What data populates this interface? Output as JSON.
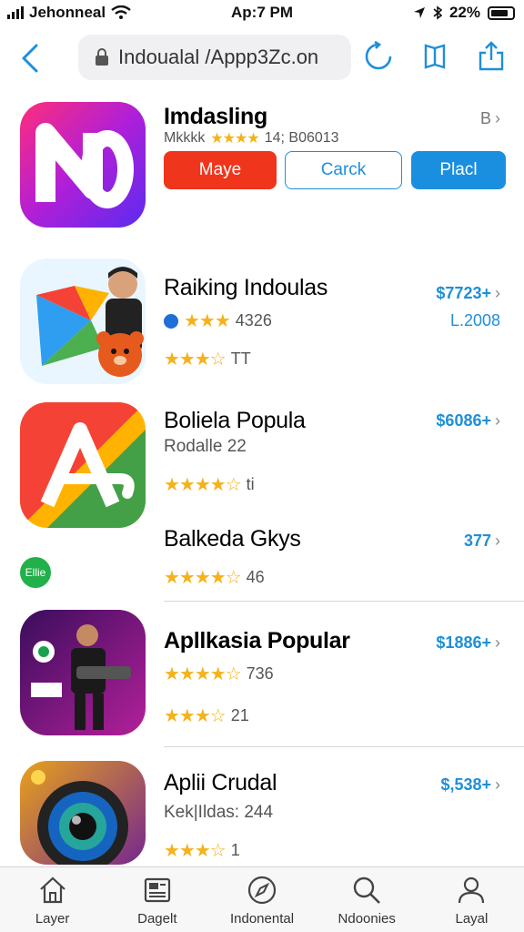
{
  "status": {
    "carrier": "Jehonneal",
    "time": "Ap:7 PM",
    "battery": "22%"
  },
  "nav": {
    "url": "Indoualal /Appp3Zc.on"
  },
  "apps": [
    {
      "title": "Imdasling",
      "subtitle_text": "Mkkkk",
      "stars": "★★★★",
      "meta": "14; B06013",
      "price": "B",
      "price2": ""
    },
    {
      "title": "Raiking Indoulas",
      "subtitle_text": "",
      "stars": "★★★",
      "meta": "4326",
      "stars2": "★★★☆",
      "meta2": "TT",
      "price": "$7723+",
      "price2": "L.2008"
    },
    {
      "title": "Boliela Popula",
      "subtitle_text": "Rodalle 22",
      "stars": "★★★★☆",
      "meta": "ti",
      "price": "$6086+"
    },
    {
      "title": "Balkeda Gkys",
      "stars": "★★★★☆",
      "meta": "46",
      "price": "377"
    },
    {
      "title": "Apllkasia Popular",
      "stars": "★★★★☆",
      "meta": "736",
      "stars2": "★★★☆",
      "meta2": "21",
      "price": "$1886+"
    },
    {
      "title": "Aplii Crudal",
      "subtitle_text": "Kek|Ildas: 244",
      "stars": "★★★☆",
      "meta": "1",
      "price": "$,538+"
    }
  ],
  "buttons": {
    "red": "Maye",
    "outline": "Carck",
    "blue": "Placl"
  },
  "badge": "Ellie",
  "tabs": [
    {
      "label": "Layer",
      "icon": "home-icon"
    },
    {
      "label": "Dagelt",
      "icon": "news-icon"
    },
    {
      "label": "Indonental",
      "icon": "compass-icon"
    },
    {
      "label": "Ndoonies",
      "icon": "search-icon"
    },
    {
      "label": "Layal",
      "icon": "account-icon"
    }
  ],
  "colors": {
    "accent": "#1e8fd8",
    "red": "#f0351d",
    "star": "#f4b21b"
  }
}
